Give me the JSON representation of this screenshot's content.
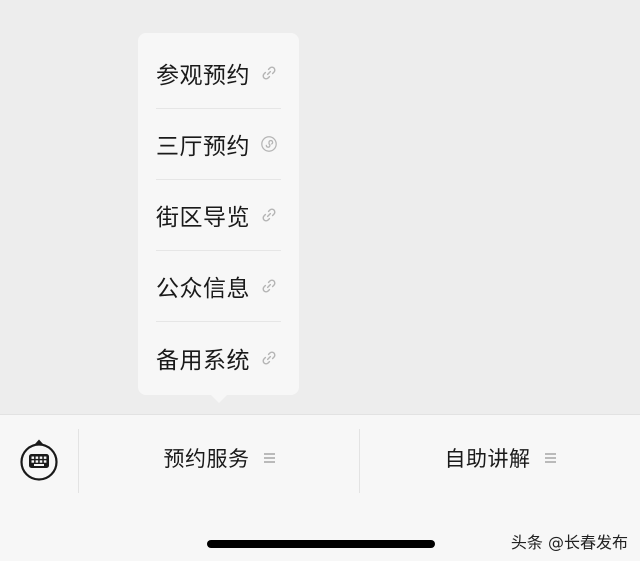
{
  "popup_menu": {
    "items": [
      {
        "label": "参观预约",
        "icon": "link-icon"
      },
      {
        "label": "三厅预约",
        "icon": "mini-program-icon"
      },
      {
        "label": "街区导览",
        "icon": "link-icon"
      },
      {
        "label": "公众信息",
        "icon": "link-icon"
      },
      {
        "label": "备用系统",
        "icon": "link-icon"
      }
    ]
  },
  "bottom_bar": {
    "keyboard_icon": "keyboard-toggle-icon",
    "tabs": [
      {
        "label": "预约服务",
        "icon": "menu-lines-icon"
      },
      {
        "label": "自助讲解",
        "icon": "menu-lines-icon"
      }
    ]
  },
  "watermark": "头条 @长春发布",
  "colors": {
    "background": "#ededed",
    "panel": "#f7f7f7",
    "text": "#1a1a1a",
    "icon_gray": "#b5b5b5"
  }
}
